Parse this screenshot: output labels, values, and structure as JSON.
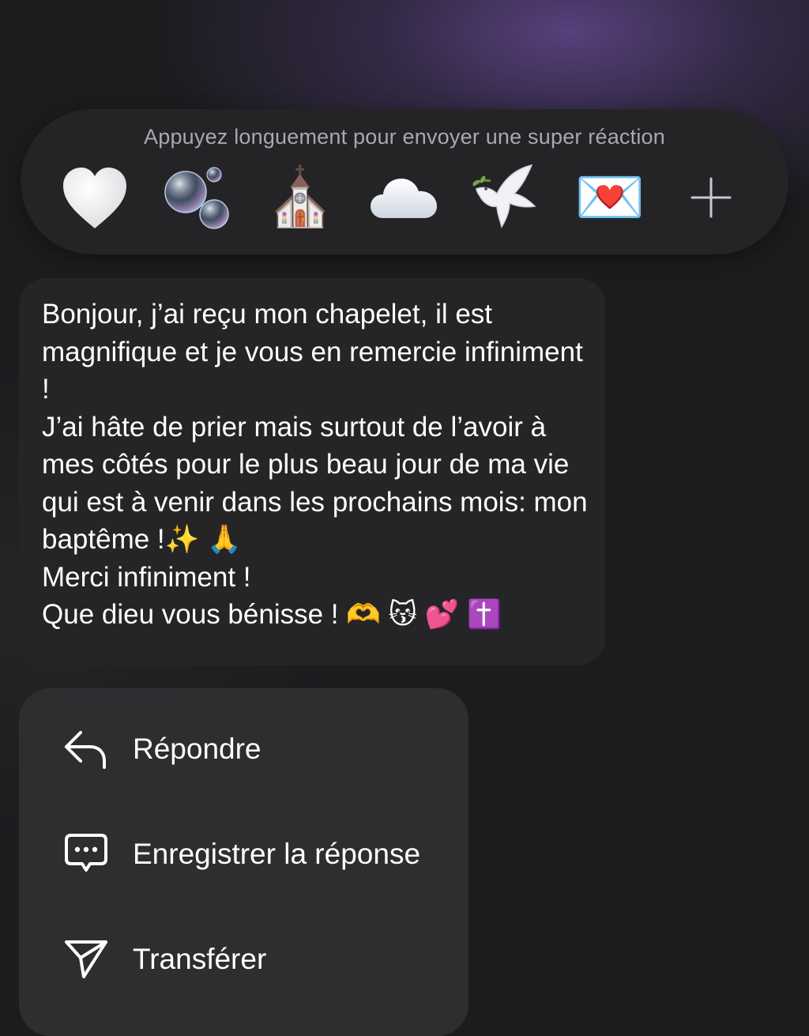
{
  "reaction_bar": {
    "hint": "Appuyez longuement pour envoyer une super réaction",
    "reactions": [
      {
        "name": "white-heart",
        "glyph": ""
      },
      {
        "name": "bubbles",
        "glyph": ""
      },
      {
        "name": "church",
        "glyph": "⛪"
      },
      {
        "name": "cloud",
        "glyph": ""
      },
      {
        "name": "dove",
        "glyph": ""
      },
      {
        "name": "love-letter",
        "glyph": "💌"
      },
      {
        "name": "add-reaction",
        "glyph": ""
      }
    ]
  },
  "message": {
    "text": "Bonjour, j’ai reçu mon chapelet, il est magnifique et je vous en remercie infiniment !\nJ’ai hâte de prier mais surtout de l’avoir à mes côtés pour le plus beau jour de ma vie qui est à venir dans les prochains mois: mon baptême !✨ 🙏\nMerci infiniment !\nQue dieu vous bénisse ! 🫶 😽 💕 ✝️"
  },
  "actions": {
    "reply": "Répondre",
    "save_reply": "Enregistrer la réponse",
    "forward": "Transférer"
  },
  "colors": {
    "background": "#1c1c1f",
    "accent_glow": "#62468c",
    "bubble": "#252528",
    "menu": "#2e2e31",
    "hint_text": "#a9a9ae"
  }
}
